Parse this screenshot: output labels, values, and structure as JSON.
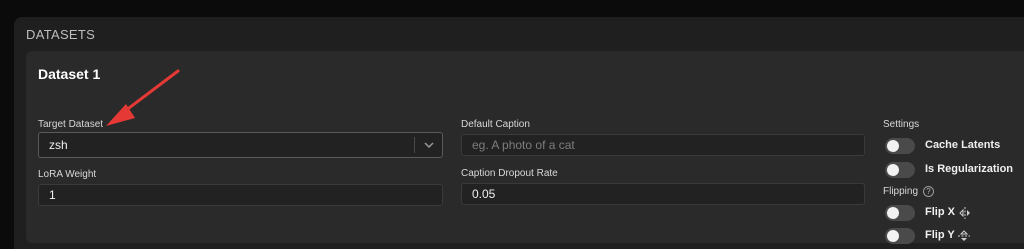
{
  "section": {
    "title": "DATASETS"
  },
  "dataset": {
    "title": "Dataset 1",
    "target_dataset": {
      "label": "Target Dataset",
      "value": "zsh"
    },
    "lora_weight": {
      "label": "LoRA Weight",
      "value": "1"
    },
    "default_caption": {
      "label": "Default Caption",
      "placeholder": "eg. A photo of a cat"
    },
    "caption_dropout": {
      "label": "Caption Dropout Rate",
      "value": "0.05"
    },
    "settings": {
      "label": "Settings",
      "cache_latents": "Cache Latents",
      "is_regularization": "Is Regularization",
      "flipping": "Flipping",
      "flip_x": "Flip X",
      "flip_y": "Flip Y"
    }
  },
  "colors": {
    "annotation_arrow": "#e53935"
  },
  "icons": [
    "chevron-down-icon",
    "help-icon",
    "flip-horizontal-icon",
    "flip-vertical-icon"
  ]
}
